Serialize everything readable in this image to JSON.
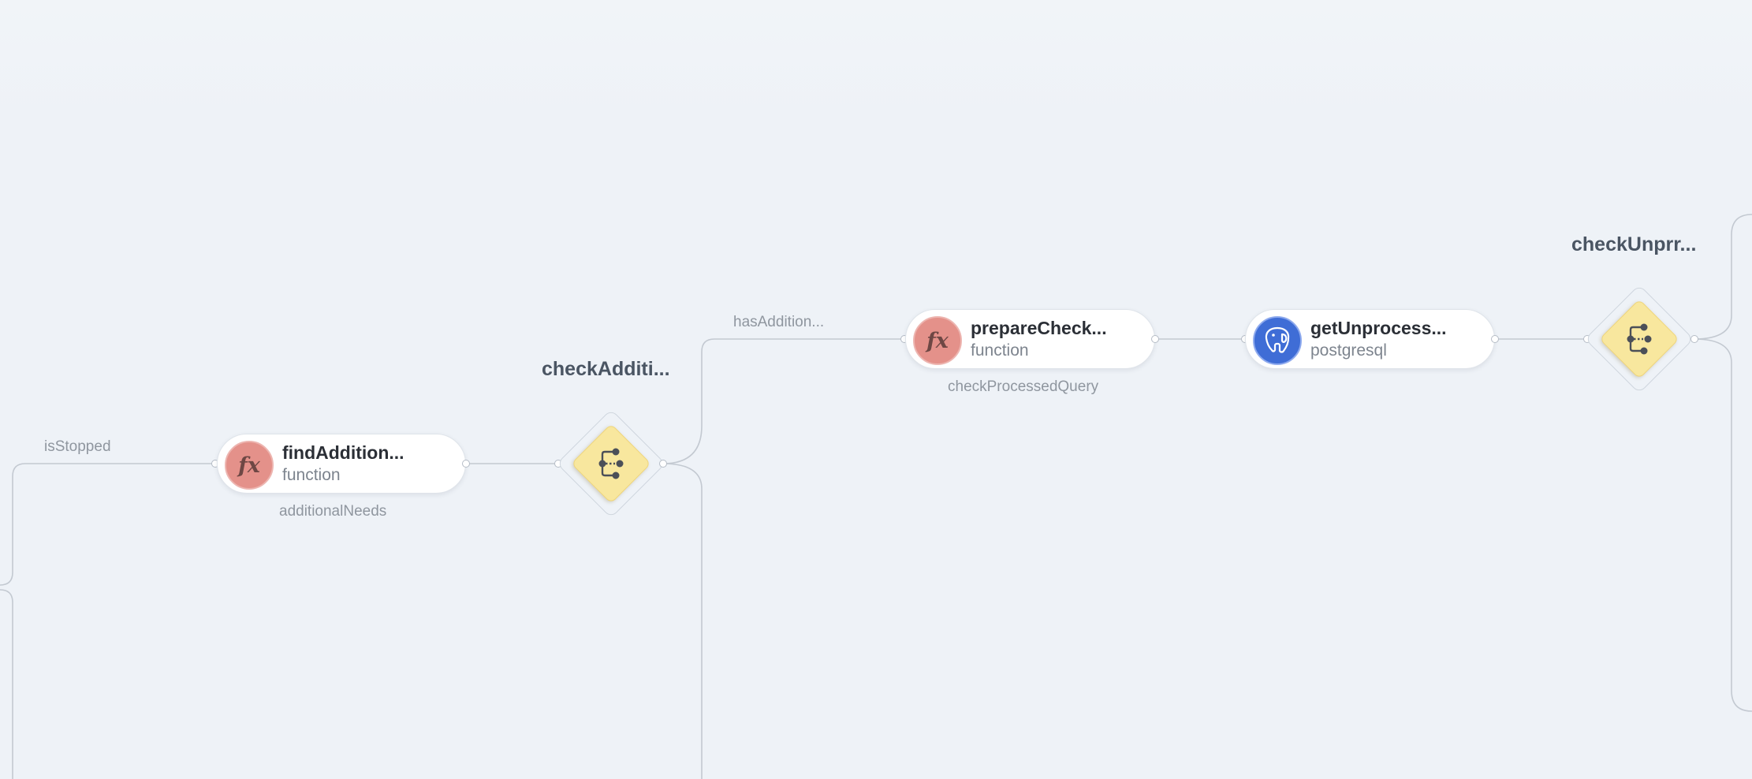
{
  "edge_labels": {
    "is_stopped": "isStopped",
    "has_additional": "hasAddition..."
  },
  "nodes": {
    "find_additional": {
      "title": "findAddition...",
      "type": "function",
      "caption": "additionalNeeds",
      "icon": "function-icon"
    },
    "prepare_check": {
      "title": "prepareCheck...",
      "type": "function",
      "caption": "checkProcessedQuery",
      "icon": "function-icon"
    },
    "get_unprocessed": {
      "title": "getUnprocess...",
      "type": "postgresql",
      "icon": "postgresql-elephant-icon"
    }
  },
  "conditions": {
    "check_additional": {
      "title": "checkAdditi...",
      "icon": "branch-condition-icon"
    },
    "check_unprocessed": {
      "title": "checkUnprr...",
      "icon": "branch-condition-icon"
    }
  },
  "icon_glyphs": {
    "function": "fx"
  },
  "colors": {
    "canvas": "#eef2f7",
    "function_badge": "#e4918a",
    "postgres_badge": "#3f6dd6",
    "condition_fill": "#f8e79e",
    "edge": "#c3c9d1"
  }
}
